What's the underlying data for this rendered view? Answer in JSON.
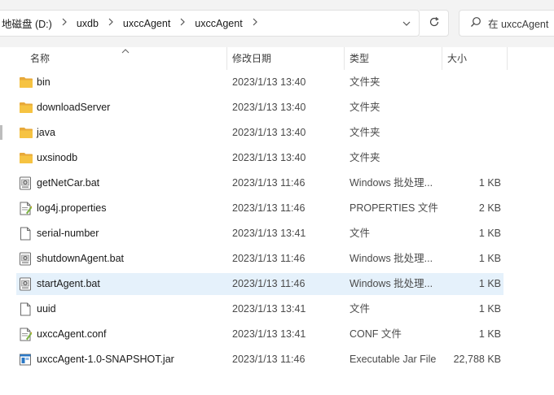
{
  "address": {
    "crumbs": [
      "地磁盘 (D:)",
      "uxdb",
      "uxccAgent",
      "uxccAgent"
    ],
    "search_placeholder": "在 uxccAgent"
  },
  "header": {
    "name": "名称",
    "date": "修改日期",
    "type": "类型",
    "size": "大小"
  },
  "files": [
    {
      "name": "bin",
      "date": "2023/1/13 13:40",
      "type": "文件夹",
      "size": "",
      "icon": "folder-icon"
    },
    {
      "name": "downloadServer",
      "date": "2023/1/13 13:40",
      "type": "文件夹",
      "size": "",
      "icon": "folder-icon"
    },
    {
      "name": "java",
      "date": "2023/1/13 13:40",
      "type": "文件夹",
      "size": "",
      "icon": "folder-icon"
    },
    {
      "name": "uxsinodb",
      "date": "2023/1/13 13:40",
      "type": "文件夹",
      "size": "",
      "icon": "folder-icon"
    },
    {
      "name": "getNetCar.bat",
      "date": "2023/1/13 11:46",
      "type": "Windows 批处理...",
      "size": "1 KB",
      "icon": "batch-file-icon"
    },
    {
      "name": "log4j.properties",
      "date": "2023/1/13 11:46",
      "type": "PROPERTIES 文件",
      "size": "2 KB",
      "icon": "config-file-icon"
    },
    {
      "name": "serial-number",
      "date": "2023/1/13 13:41",
      "type": "文件",
      "size": "1 KB",
      "icon": "blank-file-icon"
    },
    {
      "name": "shutdownAgent.bat",
      "date": "2023/1/13 11:46",
      "type": "Windows 批处理...",
      "size": "1 KB",
      "icon": "batch-file-icon"
    },
    {
      "name": "startAgent.bat",
      "date": "2023/1/13 11:46",
      "type": "Windows 批处理...",
      "size": "1 KB",
      "icon": "batch-file-icon",
      "selected": true
    },
    {
      "name": "uuid",
      "date": "2023/1/13 13:41",
      "type": "文件",
      "size": "1 KB",
      "icon": "blank-file-icon"
    },
    {
      "name": "uxccAgent.conf",
      "date": "2023/1/13 13:41",
      "type": "CONF 文件",
      "size": "1 KB",
      "icon": "config-file-icon"
    },
    {
      "name": "uxccAgent-1.0-SNAPSHOT.jar",
      "date": "2023/1/13 11:46",
      "type": "Executable Jar File",
      "size": "22,788 KB",
      "icon": "jar-file-icon"
    }
  ],
  "colors": {
    "selected_row": "#e5f1fb",
    "folder": "#f6c342"
  }
}
